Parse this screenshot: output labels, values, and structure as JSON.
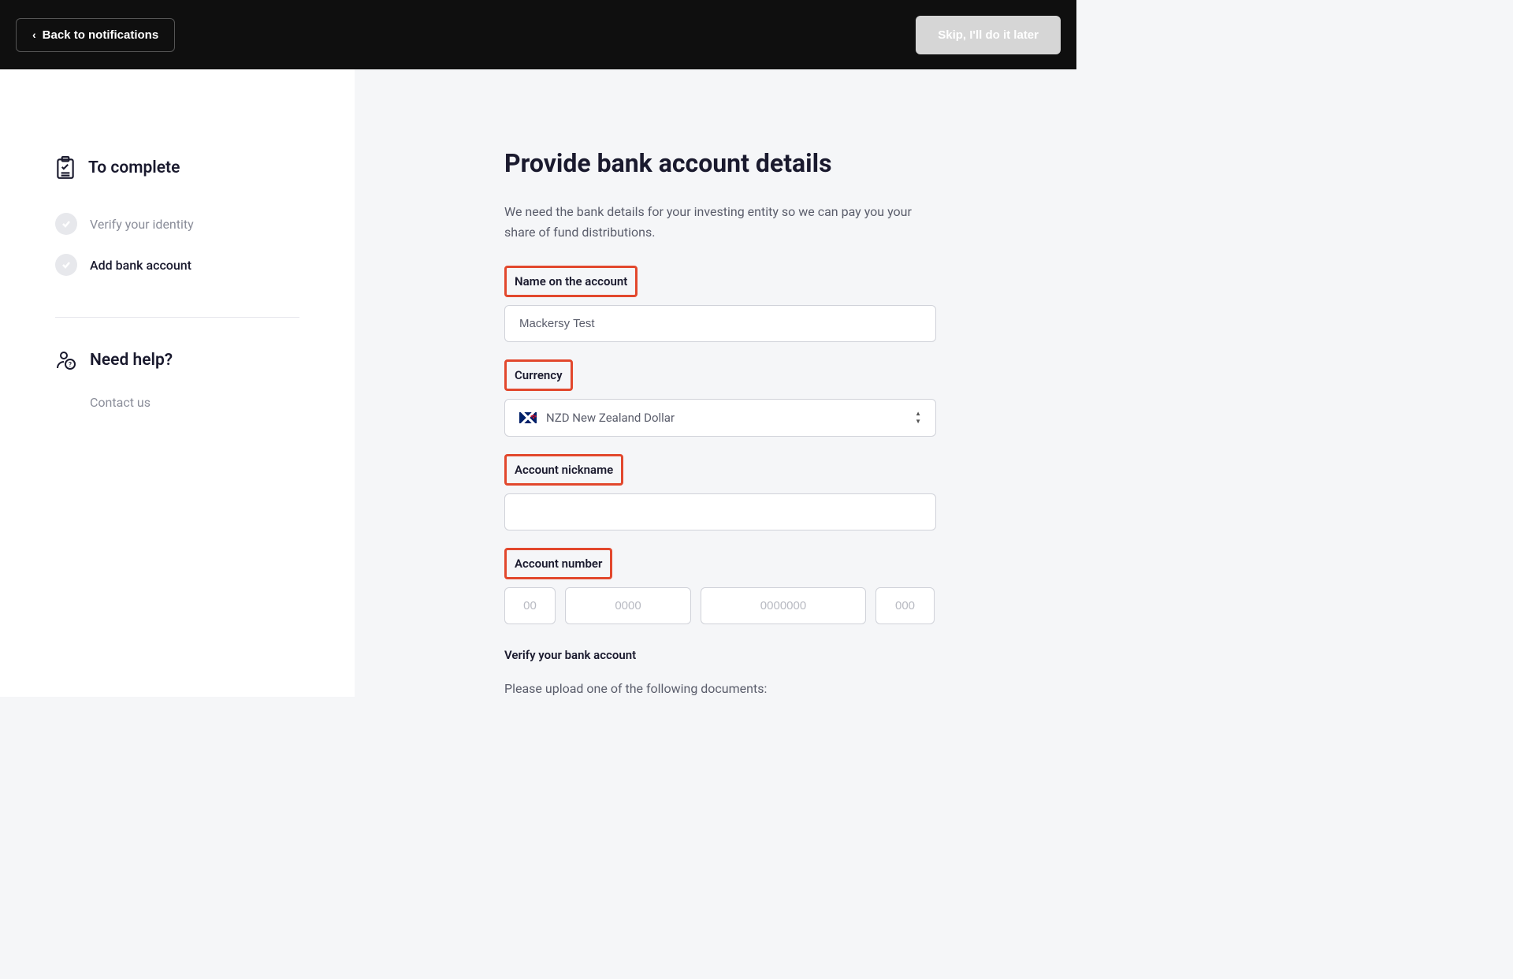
{
  "topbar": {
    "back_label": "Back to notifications",
    "skip_label": "Skip, I'll do it later"
  },
  "sidebar": {
    "to_complete_heading": "To complete",
    "steps": [
      {
        "label": "Verify your identity"
      },
      {
        "label": "Add bank account"
      }
    ],
    "help_heading": "Need help?",
    "contact_label": "Contact us"
  },
  "form": {
    "title": "Provide bank account details",
    "description": "We need the bank details for your investing entity so we can pay you your share of fund distributions.",
    "name_label": "Name on the account",
    "name_value": "Mackersy Test",
    "currency_label": "Currency",
    "currency_value": "NZD New Zealand Dollar",
    "nickname_label": "Account nickname",
    "nickname_value": "",
    "account_number_label": "Account number",
    "acct_placeholders": {
      "p1": "00",
      "p2": "0000",
      "p3": "0000000",
      "p4": "000"
    },
    "verify_heading": "Verify your bank account",
    "upload_text": "Please upload one of the following documents:"
  }
}
